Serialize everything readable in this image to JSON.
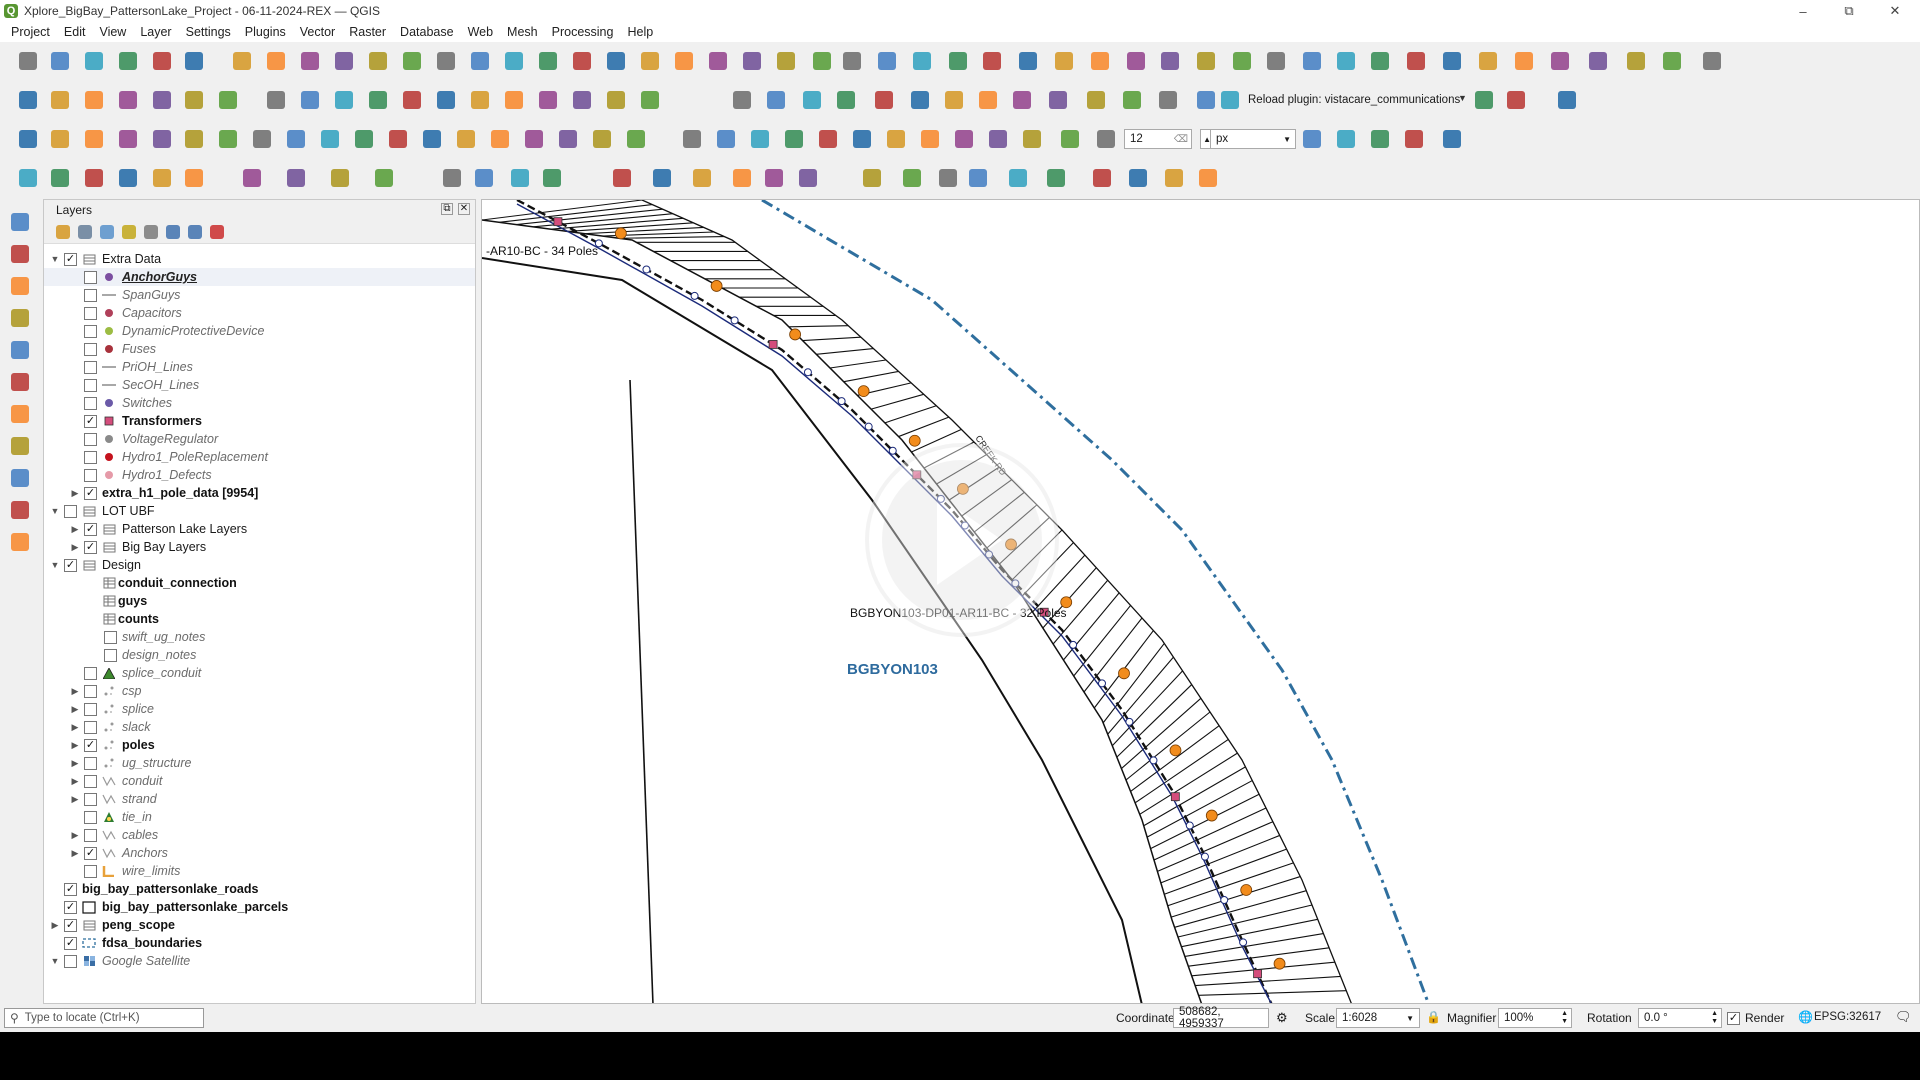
{
  "window": {
    "title": "Xplore_BigBay_PattersonLake_Project - 06-11-2024-REX — QGIS",
    "minimize": "–",
    "maximize": "⧉",
    "close": "✕"
  },
  "menu": [
    "Project",
    "Edit",
    "View",
    "Layer",
    "Settings",
    "Plugins",
    "Vector",
    "Raster",
    "Database",
    "Web",
    "Mesh",
    "Processing",
    "Help"
  ],
  "toolbar": {
    "reload_plugin_label": "Reload plugin: vistacare_communications",
    "snap_tolerance": "12",
    "snap_unit": "px"
  },
  "layers_panel": {
    "title": "Layers",
    "tree": [
      {
        "label": "Extra Data",
        "level": 0,
        "expand": "open",
        "checked": true,
        "style": "normal",
        "sym": "group"
      },
      {
        "label": "AnchorGuys",
        "level": 1,
        "expand": "",
        "checked": false,
        "style": "ital-bold-ul",
        "sym": "dot",
        "color": "#7b4ea0",
        "selected": true
      },
      {
        "label": "SpanGuys",
        "level": 1,
        "expand": "",
        "checked": false,
        "style": "ital",
        "sym": "line",
        "color": "#8a8a8a"
      },
      {
        "label": "Capacitors",
        "level": 1,
        "expand": "",
        "checked": false,
        "style": "ital",
        "sym": "dot",
        "color": "#b0405a"
      },
      {
        "label": "DynamicProtectiveDevice",
        "level": 1,
        "expand": "",
        "checked": false,
        "style": "ital",
        "sym": "dot",
        "color": "#9cbc43"
      },
      {
        "label": "Fuses",
        "level": 1,
        "expand": "",
        "checked": false,
        "style": "ital",
        "sym": "dot",
        "color": "#a8323c"
      },
      {
        "label": "PriOH_Lines",
        "level": 1,
        "expand": "",
        "checked": false,
        "style": "ital",
        "sym": "line",
        "color": "#8a8a8a"
      },
      {
        "label": "SecOH_Lines",
        "level": 1,
        "expand": "",
        "checked": false,
        "style": "ital",
        "sym": "line",
        "color": "#8a8a8a"
      },
      {
        "label": "Switches",
        "level": 1,
        "expand": "",
        "checked": false,
        "style": "ital",
        "sym": "dot",
        "color": "#6b5aa8"
      },
      {
        "label": "Transformers",
        "level": 1,
        "expand": "",
        "checked": true,
        "style": "bold",
        "sym": "square",
        "color": "#d44d7c"
      },
      {
        "label": "VoltageRegulator",
        "level": 1,
        "expand": "",
        "checked": false,
        "style": "ital",
        "sym": "dot",
        "color": "#8a8a8a"
      },
      {
        "label": "Hydro1_PoleReplacement",
        "level": 1,
        "expand": "",
        "checked": false,
        "style": "ital",
        "sym": "dot",
        "color": "#c4121d"
      },
      {
        "label": "Hydro1_Defects",
        "level": 1,
        "expand": "",
        "checked": false,
        "style": "ital",
        "sym": "dot",
        "color": "#e59aa8"
      },
      {
        "label": "extra_h1_pole_data [9954]",
        "level": 1,
        "expand": "closed",
        "checked": true,
        "style": "bold",
        "sym": "none"
      },
      {
        "label": "LOT UBF",
        "level": 0,
        "expand": "open",
        "checked": false,
        "style": "normal",
        "sym": "group"
      },
      {
        "label": "Patterson Lake Layers",
        "level": 1,
        "expand": "closed",
        "checked": true,
        "style": "normal",
        "sym": "group"
      },
      {
        "label": "Big Bay Layers",
        "level": 1,
        "expand": "closed",
        "checked": true,
        "style": "normal",
        "sym": "group"
      },
      {
        "label": "Design",
        "level": 0,
        "expand": "open",
        "checked": true,
        "style": "normal",
        "sym": "group"
      },
      {
        "label": "conduit_connection",
        "level": 1,
        "expand": "",
        "checked": null,
        "style": "bold",
        "sym": "table"
      },
      {
        "label": "guys",
        "level": 1,
        "expand": "",
        "checked": null,
        "style": "bold",
        "sym": "table"
      },
      {
        "label": "counts",
        "level": 1,
        "expand": "",
        "checked": null,
        "style": "bold",
        "sym": "table"
      },
      {
        "label": "swift_ug_notes",
        "level": 2,
        "expand": "",
        "checked": false,
        "style": "ital",
        "sym": "none"
      },
      {
        "label": "design_notes",
        "level": 2,
        "expand": "",
        "checked": false,
        "style": "ital",
        "sym": "none"
      },
      {
        "label": "splice_conduit",
        "level": 1,
        "expand": "",
        "checked": false,
        "style": "ital",
        "sym": "triangle",
        "color": "#3e8a2e"
      },
      {
        "label": "csp",
        "level": 1,
        "expand": "closed",
        "checked": false,
        "style": "ital",
        "sym": "points"
      },
      {
        "label": "splice",
        "level": 1,
        "expand": "closed",
        "checked": false,
        "style": "ital",
        "sym": "points"
      },
      {
        "label": "slack",
        "level": 1,
        "expand": "closed",
        "checked": false,
        "style": "ital",
        "sym": "points"
      },
      {
        "label": "poles",
        "level": 1,
        "expand": "closed",
        "checked": true,
        "style": "bold",
        "sym": "points"
      },
      {
        "label": "ug_structure",
        "level": 1,
        "expand": "closed",
        "checked": false,
        "style": "ital",
        "sym": "points"
      },
      {
        "label": "conduit",
        "level": 1,
        "expand": "closed",
        "checked": false,
        "style": "ital",
        "sym": "lines"
      },
      {
        "label": "strand",
        "level": 1,
        "expand": "closed",
        "checked": false,
        "style": "ital",
        "sym": "lines"
      },
      {
        "label": "tie_in",
        "level": 1,
        "expand": "",
        "checked": false,
        "style": "ital",
        "sym": "tie"
      },
      {
        "label": "cables",
        "level": 1,
        "expand": "closed",
        "checked": false,
        "style": "ital",
        "sym": "lines"
      },
      {
        "label": "Anchors",
        "level": 1,
        "expand": "closed",
        "checked": true,
        "style": "ital",
        "sym": "lines"
      },
      {
        "label": "wire_limits",
        "level": 1,
        "expand": "",
        "checked": false,
        "style": "ital",
        "sym": "bracket"
      },
      {
        "label": "big_bay_pattersonlake_roads",
        "level": 0,
        "expand": "",
        "checked": true,
        "style": "bold",
        "sym": "none"
      },
      {
        "label": "big_bay_pattersonlake_parcels",
        "level": 0,
        "expand": "",
        "checked": true,
        "style": "bold",
        "sym": "box"
      },
      {
        "label": "peng_scope",
        "level": 0,
        "expand": "closed",
        "checked": true,
        "style": "bold",
        "sym": "group"
      },
      {
        "label": "fdsa_boundaries",
        "level": 0,
        "expand": "",
        "checked": true,
        "style": "bold",
        "sym": "dash"
      },
      {
        "label": "Google Satellite",
        "level": 0,
        "expand": "open",
        "checked": false,
        "style": "ital",
        "sym": "raster"
      }
    ]
  },
  "map": {
    "label_top": "-AR10-BC - 34 Poles",
    "label_mid": "BGBYON103-DP01-AR11-BC - 32 Poles",
    "area_label": "BGBYON103",
    "road_label": "CREEK RD"
  },
  "status": {
    "locate_placeholder": "Type to locate (Ctrl+K)",
    "coordinate_label": "Coordinate",
    "coordinate_value": "508682, 4959337",
    "scale_label": "Scale",
    "scale_value": "1:6028",
    "magnifier_label": "Magnifier",
    "magnifier_value": "100%",
    "rotation_label": "Rotation",
    "rotation_value": "0.0 °",
    "render_label": "Render",
    "render_checked": true,
    "crs": "EPSG:32617"
  },
  "colors": {
    "accent": "#3a6ea5",
    "boundary": "#2f6f9e",
    "pole": "#f28c1c",
    "transformer": "#d44d7c",
    "area_label": "#2e6b9e"
  }
}
